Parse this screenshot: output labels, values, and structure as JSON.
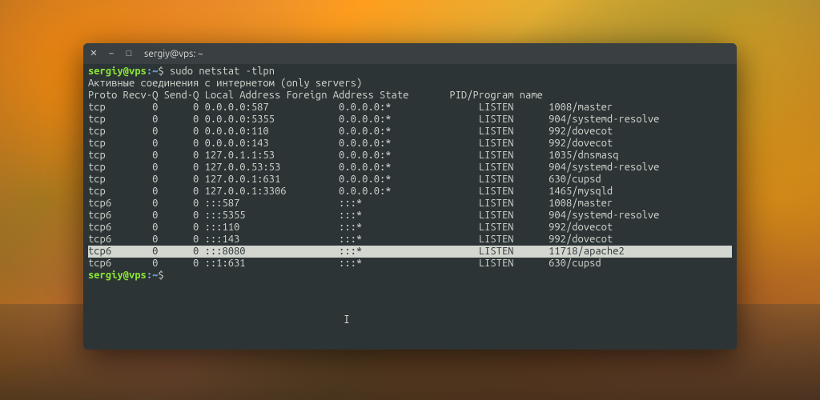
{
  "window": {
    "title": "sergiy@vps: ~",
    "close_icon": "✕",
    "min_icon": "–",
    "max_icon": "□"
  },
  "prompt": {
    "userhost": "sergiy@vps",
    "colon": ":",
    "path": "~",
    "dollar": "$ "
  },
  "command": "sudo netstat -tlpn",
  "output_header1": "Активные соединения с интернетом (only servers)",
  "columns_line": "Proto Recv-Q Send-Q Local Address Foreign Address State       PID/Program name",
  "rows": [
    {
      "proto": "tcp",
      "recvq": "0",
      "sendq": "0",
      "local": "0.0.0.0:587",
      "foreign": "0.0.0.0:*",
      "state": "LISTEN",
      "pid": "1008/master",
      "hl": false
    },
    {
      "proto": "tcp",
      "recvq": "0",
      "sendq": "0",
      "local": "0.0.0.0:5355",
      "foreign": "0.0.0.0:*",
      "state": "LISTEN",
      "pid": "904/systemd-resolve",
      "hl": false
    },
    {
      "proto": "tcp",
      "recvq": "0",
      "sendq": "0",
      "local": "0.0.0.0:110",
      "foreign": "0.0.0.0:*",
      "state": "LISTEN",
      "pid": "992/dovecot",
      "hl": false
    },
    {
      "proto": "tcp",
      "recvq": "0",
      "sendq": "0",
      "local": "0.0.0.0:143",
      "foreign": "0.0.0.0:*",
      "state": "LISTEN",
      "pid": "992/dovecot",
      "hl": false
    },
    {
      "proto": "tcp",
      "recvq": "0",
      "sendq": "0",
      "local": "127.0.1.1:53",
      "foreign": "0.0.0.0:*",
      "state": "LISTEN",
      "pid": "1035/dnsmasq",
      "hl": false
    },
    {
      "proto": "tcp",
      "recvq": "0",
      "sendq": "0",
      "local": "127.0.0.53:53",
      "foreign": "0.0.0.0:*",
      "state": "LISTEN",
      "pid": "904/systemd-resolve",
      "hl": false
    },
    {
      "proto": "tcp",
      "recvq": "0",
      "sendq": "0",
      "local": "127.0.0.1:631",
      "foreign": "0.0.0.0:*",
      "state": "LISTEN",
      "pid": "630/cupsd",
      "hl": false
    },
    {
      "proto": "tcp",
      "recvq": "0",
      "sendq": "0",
      "local": "127.0.0.1:3306",
      "foreign": "0.0.0.0:*",
      "state": "LISTEN",
      "pid": "1465/mysqld",
      "hl": false
    },
    {
      "proto": "tcp6",
      "recvq": "0",
      "sendq": "0",
      "local": ":::587",
      "foreign": ":::*",
      "state": "LISTEN",
      "pid": "1008/master",
      "hl": false
    },
    {
      "proto": "tcp6",
      "recvq": "0",
      "sendq": "0",
      "local": ":::5355",
      "foreign": ":::*",
      "state": "LISTEN",
      "pid": "904/systemd-resolve",
      "hl": false
    },
    {
      "proto": "tcp6",
      "recvq": "0",
      "sendq": "0",
      "local": ":::110",
      "foreign": ":::*",
      "state": "LISTEN",
      "pid": "992/dovecot",
      "hl": false
    },
    {
      "proto": "tcp6",
      "recvq": "0",
      "sendq": "0",
      "local": ":::143",
      "foreign": ":::*",
      "state": "LISTEN",
      "pid": "992/dovecot",
      "hl": false
    },
    {
      "proto": "tcp6",
      "recvq": "0",
      "sendq": "0",
      "local": ":::8080",
      "foreign": ":::*",
      "state": "LISTEN",
      "pid": "11718/apache2",
      "hl": true
    },
    {
      "proto": "tcp6",
      "recvq": "0",
      "sendq": "0",
      "local": "::1:631",
      "foreign": ":::*",
      "state": "LISTEN",
      "pid": "630/cupsd",
      "hl": false
    }
  ],
  "col_widths": {
    "proto": 6,
    "recvq": 7,
    "sendq": 7,
    "local": 23,
    "foreign": 24,
    "state": 12
  }
}
